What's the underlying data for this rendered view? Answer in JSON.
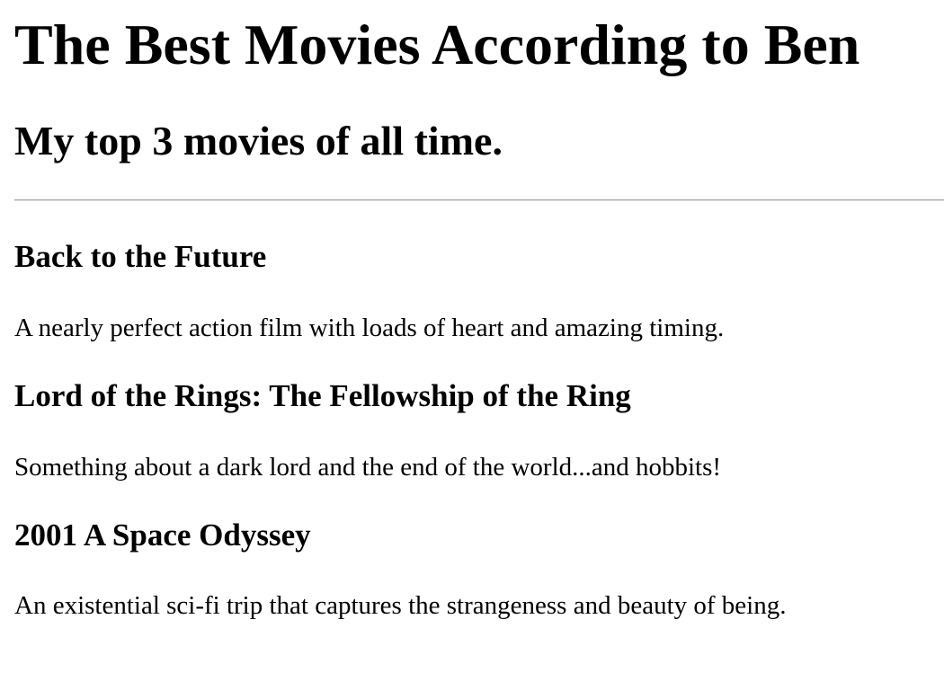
{
  "header": {
    "title": "The Best Movies According to Ben",
    "subtitle": "My top 3 movies of all time."
  },
  "movies": [
    {
      "title": "Back to the Future",
      "description": "A nearly perfect action film with loads of heart and amazing timing."
    },
    {
      "title": "Lord of the Rings: The Fellowship of the Ring",
      "description": "Something about a dark lord and the end of the world...and hobbits!"
    },
    {
      "title": "2001 A Space Odyssey",
      "description": "An existential sci-fi trip that captures the strangeness and beauty of being."
    }
  ]
}
